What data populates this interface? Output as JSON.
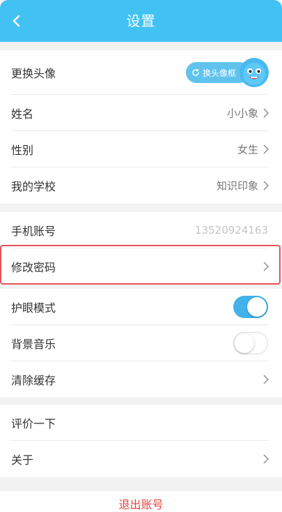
{
  "header": {
    "title": "设置"
  },
  "profile": {
    "avatar_label": "更换头像",
    "avatar_frame_button": "换头像框",
    "name_label": "姓名",
    "name_value": "小小象",
    "gender_label": "性别",
    "gender_value": "女生",
    "school_label": "我的学校",
    "school_value": "知识印象"
  },
  "account": {
    "phone_label": "手机账号",
    "phone_value": "13520924163",
    "password_label": "修改密码"
  },
  "preferences": {
    "eye_mode_label": "护眼模式",
    "eye_mode_on": true,
    "music_label": "背景音乐",
    "music_on": false,
    "cache_label": "清除缓存"
  },
  "misc": {
    "rate_label": "评价一下",
    "about_label": "关于"
  },
  "logout_label": "退出账号",
  "colors": {
    "accent": "#42c2f3",
    "toggle_on": "#42b2ea",
    "logout": "#e5403f",
    "highlight": "#e5535a"
  }
}
